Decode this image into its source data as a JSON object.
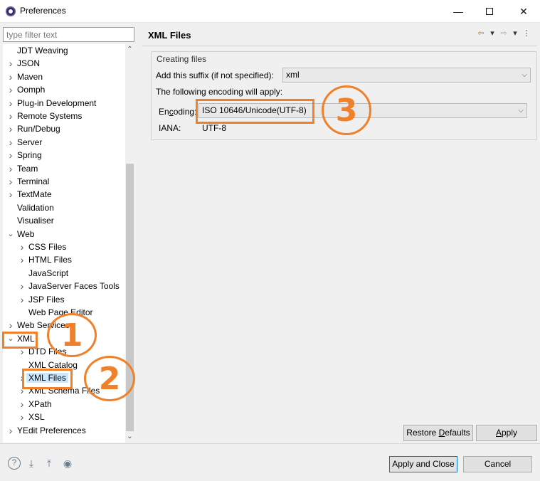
{
  "window": {
    "title": "Preferences",
    "minimize": "—",
    "close": "✕"
  },
  "filter": {
    "placeholder": "type filter text",
    "value": ""
  },
  "tree": {
    "items": [
      {
        "label": "JDT Weaving",
        "level": 0,
        "expander": ""
      },
      {
        "label": "JSON",
        "level": 0,
        "expander": ">"
      },
      {
        "label": "Maven",
        "level": 0,
        "expander": ">"
      },
      {
        "label": "Oomph",
        "level": 0,
        "expander": ">"
      },
      {
        "label": "Plug-in Development",
        "level": 0,
        "expander": ">"
      },
      {
        "label": "Remote Systems",
        "level": 0,
        "expander": ">"
      },
      {
        "label": "Run/Debug",
        "level": 0,
        "expander": ">"
      },
      {
        "label": "Server",
        "level": 0,
        "expander": ">"
      },
      {
        "label": "Spring",
        "level": 0,
        "expander": ">"
      },
      {
        "label": "Team",
        "level": 0,
        "expander": ">"
      },
      {
        "label": "Terminal",
        "level": 0,
        "expander": ">"
      },
      {
        "label": "TextMate",
        "level": 0,
        "expander": ">"
      },
      {
        "label": "Validation",
        "level": 0,
        "expander": ""
      },
      {
        "label": "Visualiser",
        "level": 0,
        "expander": ""
      },
      {
        "label": "Web",
        "level": 0,
        "expander": "v"
      },
      {
        "label": "CSS Files",
        "level": 1,
        "expander": ">"
      },
      {
        "label": "HTML Files",
        "level": 1,
        "expander": ">"
      },
      {
        "label": "JavaScript",
        "level": 1,
        "expander": ""
      },
      {
        "label": "JavaServer Faces Tools",
        "level": 1,
        "expander": ">"
      },
      {
        "label": "JSP Files",
        "level": 1,
        "expander": ">"
      },
      {
        "label": "Web Page Editor",
        "level": 1,
        "expander": ""
      },
      {
        "label": "Web Services",
        "level": 0,
        "expander": ">"
      },
      {
        "label": "XML",
        "level": 0,
        "expander": "v"
      },
      {
        "label": "DTD Files",
        "level": 1,
        "expander": ">"
      },
      {
        "label": "XML Catalog",
        "level": 1,
        "expander": ""
      },
      {
        "label": "XML Files",
        "level": 1,
        "expander": ">",
        "selected": true
      },
      {
        "label": "XML Schema Files",
        "level": 1,
        "expander": ">"
      },
      {
        "label": "XPath",
        "level": 1,
        "expander": ">"
      },
      {
        "label": "XSL",
        "level": 1,
        "expander": ">"
      },
      {
        "label": "YEdit Preferences",
        "level": 0,
        "expander": ">"
      }
    ]
  },
  "page": {
    "title": "XML Files",
    "group_label": "Creating files",
    "suffix_label": "Add this suffix (if not specified):",
    "suffix_value": "xml",
    "encoding_note": "The following encoding will apply:",
    "encoding_label_pre": "En",
    "encoding_label_accel": "c",
    "encoding_label_post": "oding:",
    "encoding_value": "ISO 10646/Unicode(UTF-8)",
    "iana_label": "IANA:",
    "iana_value": "UTF-8"
  },
  "annotations": {
    "step1": "1",
    "step2": "2",
    "step3": "3",
    "color": "#f0802a"
  },
  "buttons": {
    "restore_pre": "Restore ",
    "restore_accel": "D",
    "restore_post": "efaults",
    "apply_pre": "",
    "apply_accel": "A",
    "apply_post": "pply",
    "apply_close": "Apply and Close",
    "cancel": "Cancel"
  },
  "icons": [
    "help-icon",
    "import-icon",
    "export-icon",
    "record-icon",
    "back-icon",
    "forward-icon",
    "view-menu-icon"
  ]
}
